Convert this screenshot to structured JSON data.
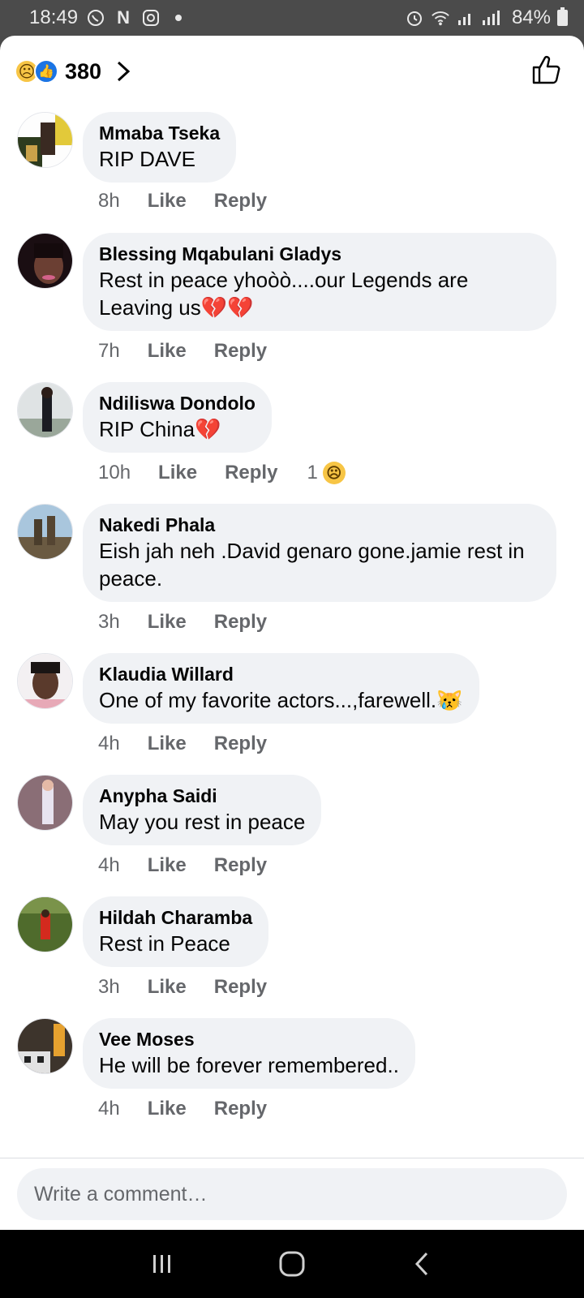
{
  "status_bar": {
    "time": "18:49",
    "left_icons": [
      "whatsapp-icon",
      "n-icon",
      "instagram-icon",
      "dot-icon"
    ],
    "n_label": "N",
    "battery": "84%"
  },
  "reactions": {
    "count": "380",
    "emojis": [
      "sad",
      "like"
    ]
  },
  "comments": [
    {
      "name": "Mmaba Tseka",
      "text": "RIP DAVE",
      "time": "8h",
      "like": "Like",
      "reply": "Reply"
    },
    {
      "name": "Blessing Mqabulani Gladys",
      "text_line1": "Rest in peace yhoòò....our Legends are",
      "text_line2": "Leaving us",
      "hearts": "💔💔",
      "time": "7h",
      "like": "Like",
      "reply": "Reply"
    },
    {
      "name": "Ndiliswa Dondolo",
      "text": "RIP China",
      "hearts": "💔",
      "time": "10h",
      "like": "Like",
      "reply": "Reply",
      "reaction_count": "1"
    },
    {
      "name": "Nakedi Phala",
      "text_line1": "Eish jah neh .David genaro gone.jamie rest in",
      "text_line2": "peace.",
      "time": "3h",
      "like": "Like",
      "reply": "Reply"
    },
    {
      "name": "Klaudia Willard",
      "text": "One of my favorite actors...,farewell.",
      "emoji": "😿",
      "time": "4h",
      "like": "Like",
      "reply": "Reply"
    },
    {
      "name": "Anypha Saidi",
      "text": "May you rest in peace",
      "time": "4h",
      "like": "Like",
      "reply": "Reply"
    },
    {
      "name": "Hildah Charamba",
      "text": "Rest in Peace",
      "time": "3h",
      "like": "Like",
      "reply": "Reply"
    },
    {
      "name": "Vee Moses",
      "text": "He will be forever remembered..",
      "time": "4h",
      "like": "Like",
      "reply": "Reply"
    }
  ],
  "composer": {
    "placeholder": "Write a comment…"
  },
  "colors": {
    "accent": "#1b74e4",
    "bubble": "#f0f2f5",
    "meta": "#65676b",
    "heart": "#e41e3f"
  }
}
